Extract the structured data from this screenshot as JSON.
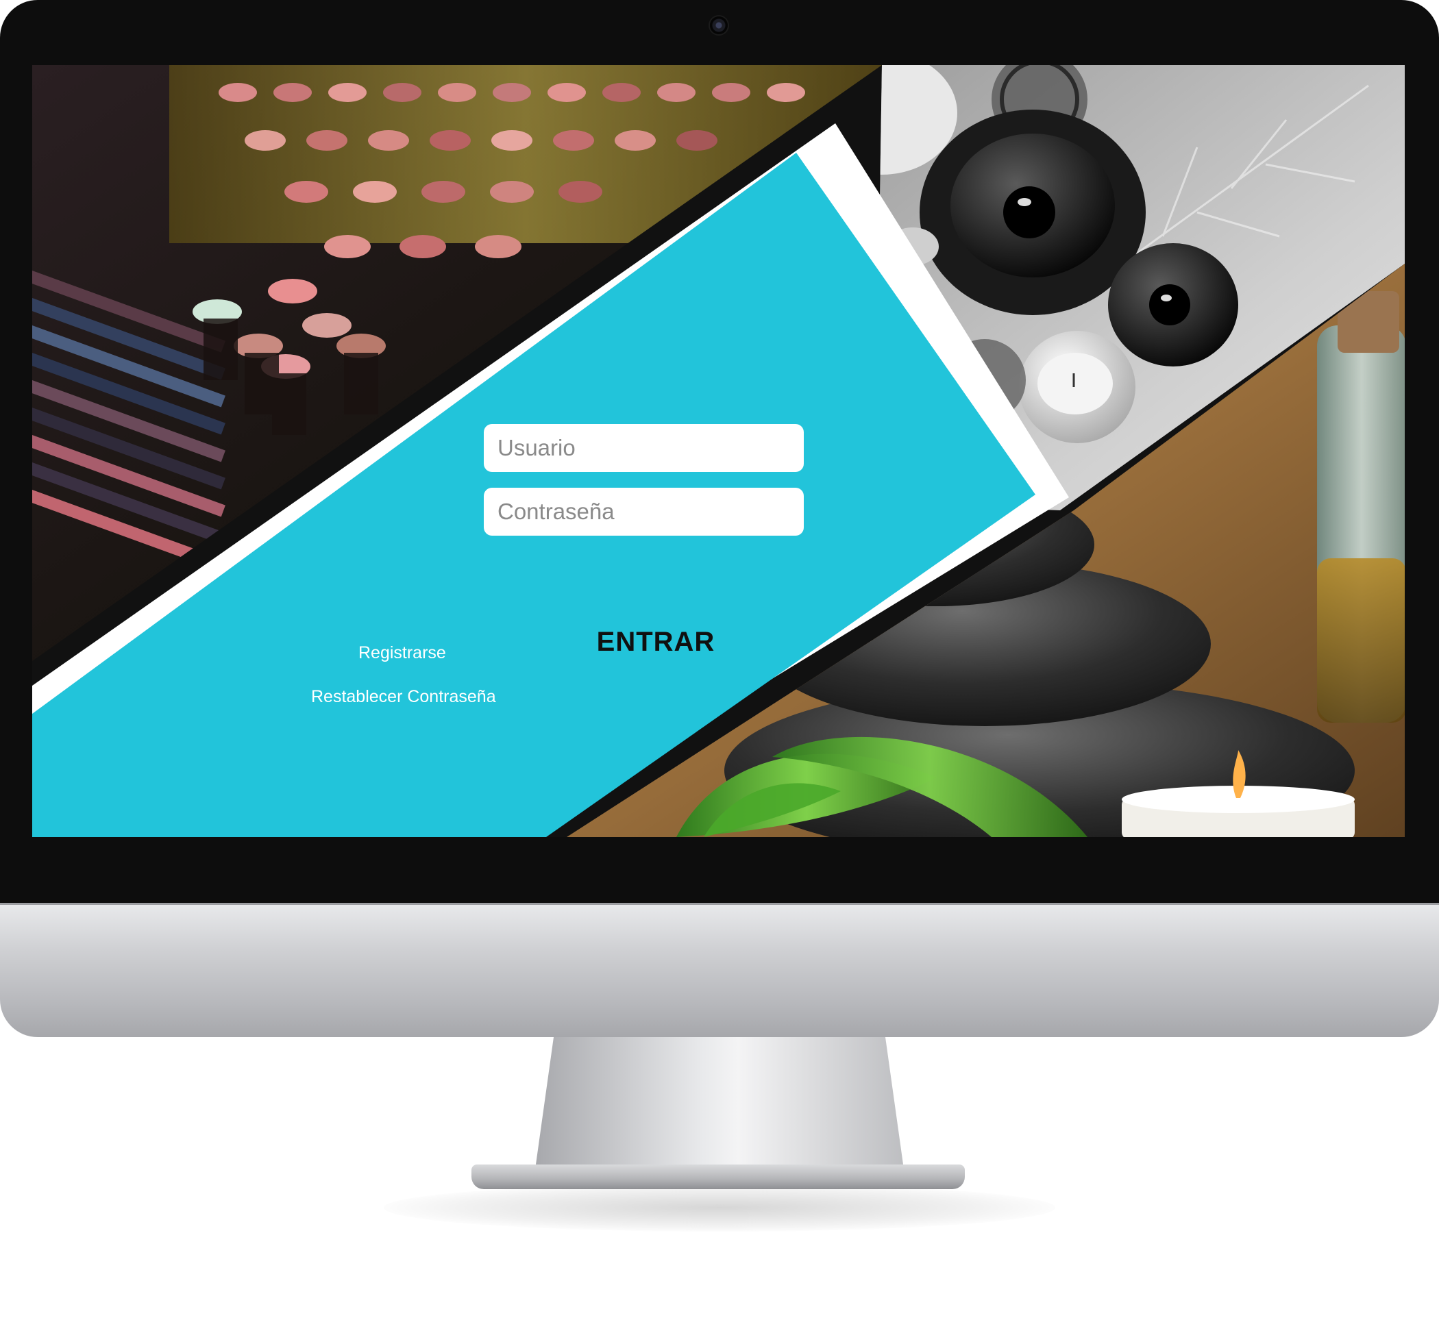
{
  "login": {
    "username_placeholder": "Usuario",
    "password_placeholder": "Contraseña",
    "submit_label": "ENTRAR",
    "register_link": "Registrarse",
    "reset_password_link": "Restablecer Contraseña"
  },
  "colors": {
    "panel_accent": "#22c4da",
    "panel_border": "#ffffff",
    "submit_text": "#101010",
    "link_text": "#ffffff"
  },
  "background_photos": [
    {
      "subject": "lipstick and makeup palettes"
    },
    {
      "subject": "black and white candles with leaves"
    },
    {
      "subject": "stacked black spa stones with green leaf, candle and oil bottle"
    }
  ]
}
